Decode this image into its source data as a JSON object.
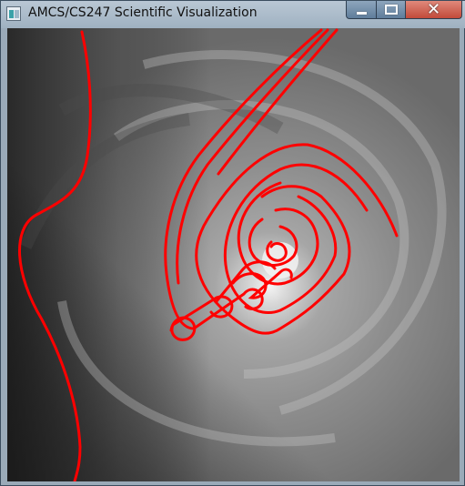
{
  "window": {
    "title": "AMCS/CS247 Scientific Visualization",
    "app_icon": "app-window-icon",
    "controls": {
      "minimize_icon": "minimize-icon",
      "maximize_icon": "maximize-icon",
      "close_icon": "close-icon",
      "close_glyph": "✕"
    }
  },
  "canvas": {
    "content": "hurricane-satellite-image-with-streamlines",
    "streamline_color": "#ff0000",
    "background": "grayscale"
  }
}
